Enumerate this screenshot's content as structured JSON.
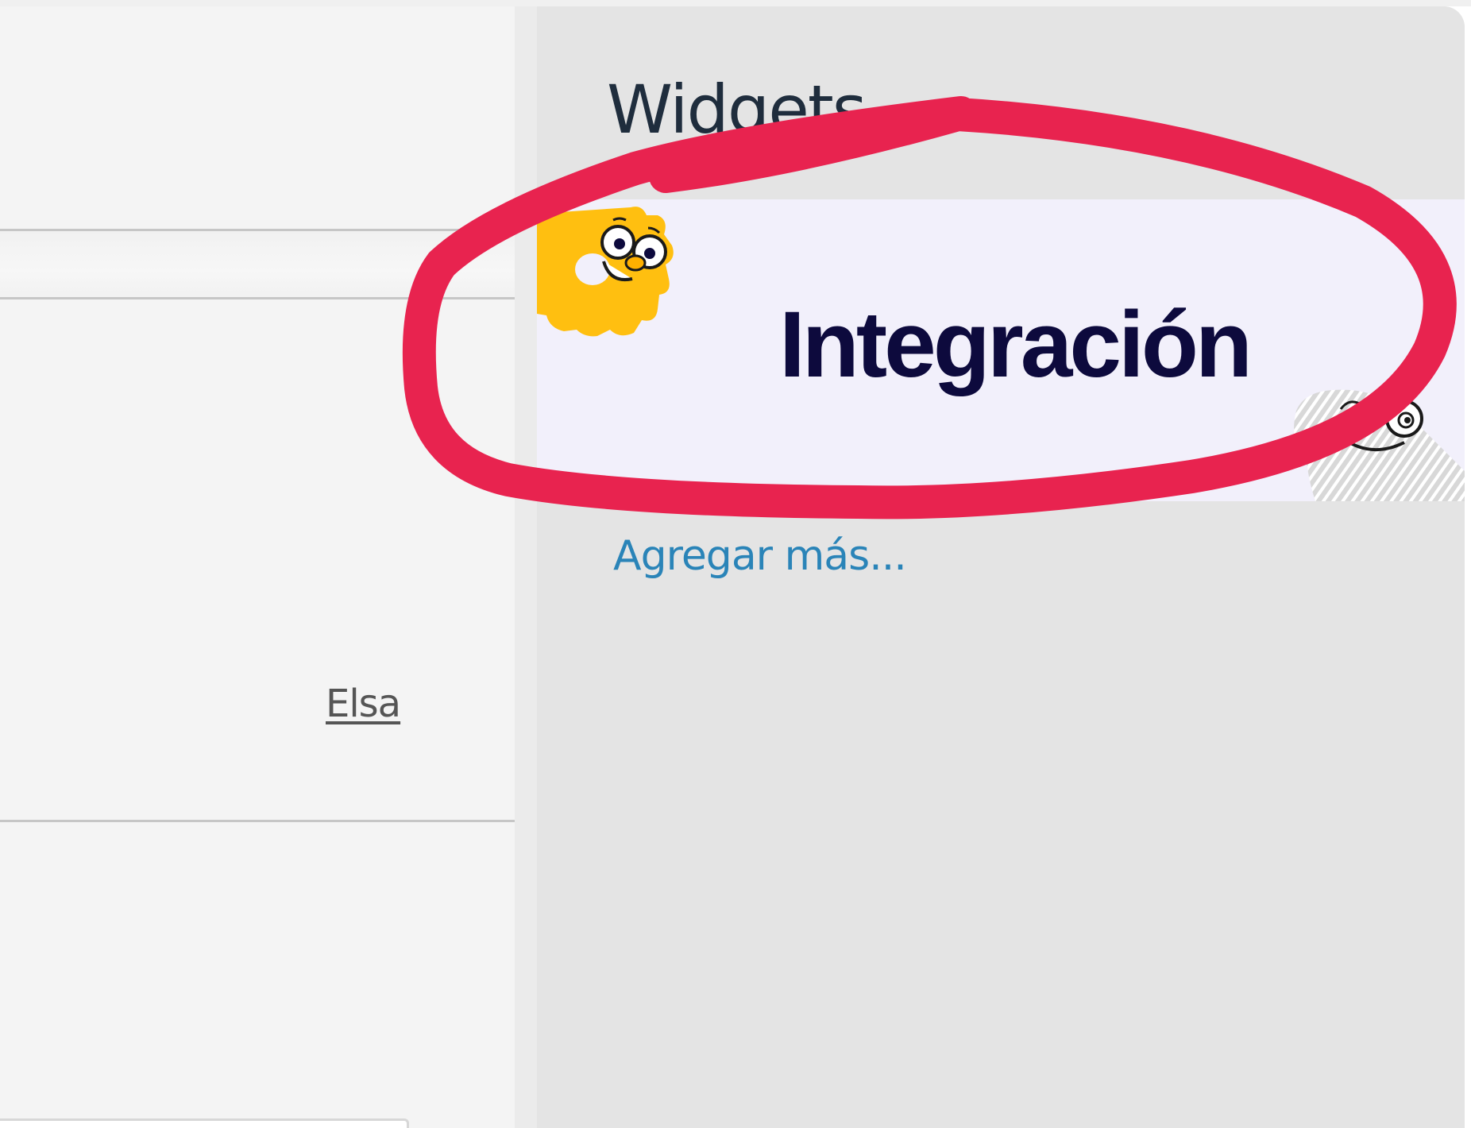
{
  "left_panel": {
    "user_link": "Elsa"
  },
  "sidebar": {
    "title": "Widgets",
    "widget": {
      "label": "Integración"
    },
    "add_more": "Agregar más..."
  },
  "colors": {
    "sidebar_bg": "#e4e4e4",
    "widget_bg": "#f2f0fb",
    "widget_text": "#0d0a3d",
    "link": "#2a84b8",
    "highlight": "#e8234f",
    "mascot": "#ffbf10"
  }
}
